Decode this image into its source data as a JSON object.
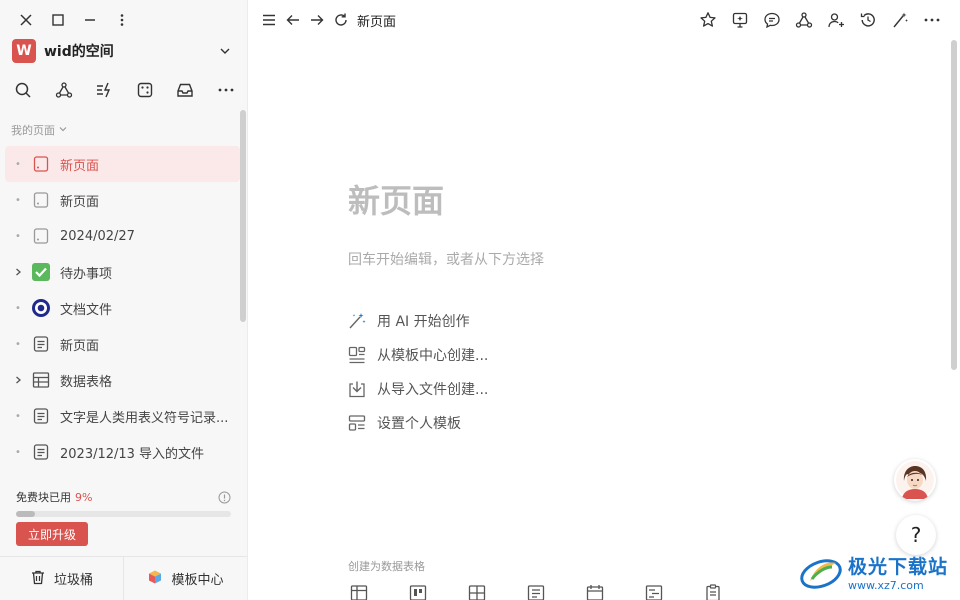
{
  "sidebar": {
    "space": {
      "logo_letter": "W",
      "name": "wid的空间"
    },
    "section_label": "我的页面",
    "pages": [
      {
        "label": "新页面",
        "icon": "page-icon",
        "lead": "dot",
        "active": true
      },
      {
        "label": "新页面",
        "icon": "page-icon",
        "lead": "dot"
      },
      {
        "label": "2024/02/27",
        "icon": "page-icon",
        "lead": "dot"
      },
      {
        "label": "待办事项",
        "icon": "checkbox-icon",
        "lead": "expand"
      },
      {
        "label": "文档文件",
        "icon": "target-icon",
        "lead": "dot"
      },
      {
        "label": "新页面",
        "icon": "doc-icon",
        "lead": "dot"
      },
      {
        "label": "数据表格",
        "icon": "table-icon",
        "lead": "expand"
      },
      {
        "label": "文字是人类用表义符号记录...",
        "icon": "doc-icon",
        "lead": "dot"
      },
      {
        "label": "2023/12/13 导入的文件",
        "icon": "doc-icon",
        "lead": "dot"
      }
    ],
    "quota": {
      "label": "免费块已用",
      "percent_text": "9%",
      "fraction": 0.09
    },
    "upgrade_label": "立即升级",
    "trash_label": "垃圾桶",
    "templates_label": "模板中心"
  },
  "topbar": {
    "breadcrumb": "新页面"
  },
  "main": {
    "title": "新页面",
    "hint": "回车开始编辑，或者从下方选择",
    "actions": [
      {
        "label": "用 AI 开始创作",
        "icon": "ai-wand-icon"
      },
      {
        "label": "从模板中心创建...",
        "icon": "template-icon"
      },
      {
        "label": "从导入文件创建...",
        "icon": "import-icon"
      },
      {
        "label": "设置个人模板",
        "icon": "personal-template-icon"
      }
    ],
    "database_label": "创建为数据表格"
  },
  "watermark": {
    "title": "极光下载站",
    "url": "www.xz7.com"
  },
  "colors": {
    "accent": "#d9534f",
    "active_bg": "#fbe9e9",
    "sidebar_bg": "#f7f7f7"
  }
}
